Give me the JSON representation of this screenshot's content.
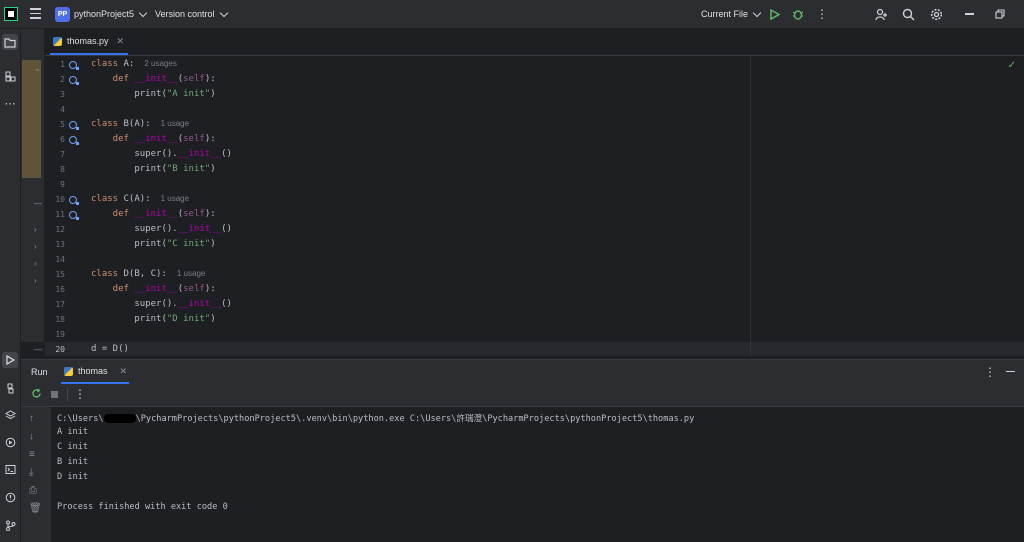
{
  "titlebar": {
    "project_badge": "PP",
    "project_name": "pythonProject5",
    "vcs_label": "Version control",
    "run_config": "Current File"
  },
  "editor": {
    "tab_label": "thomas.py",
    "lines": [
      {
        "n": "1",
        "usage": "2 usages"
      },
      {
        "n": "2"
      },
      {
        "n": "3"
      },
      {
        "n": "4"
      },
      {
        "n": "5",
        "usage": "1 usage"
      },
      {
        "n": "6"
      },
      {
        "n": "7"
      },
      {
        "n": "8"
      },
      {
        "n": "9"
      },
      {
        "n": "10",
        "usage": "1 usage"
      },
      {
        "n": "11"
      },
      {
        "n": "12"
      },
      {
        "n": "13"
      },
      {
        "n": "14"
      },
      {
        "n": "15",
        "usage": "1 usage"
      },
      {
        "n": "16"
      },
      {
        "n": "17"
      },
      {
        "n": "18"
      },
      {
        "n": "19"
      },
      {
        "n": "20"
      }
    ],
    "code": {
      "l1a": "class",
      "l1b": " A:",
      "l2a": "    def ",
      "l2b": "__init__",
      "l2c": "(",
      "l2d": "self",
      "l2e": "):",
      "l3a": "        print(",
      "l3b": "\"A init\"",
      "l3c": ")",
      "l5a": "class",
      "l5b": " B(A):",
      "l6a": "    def ",
      "l6b": "__init__",
      "l6c": "(",
      "l6d": "self",
      "l6e": "):",
      "l7a": "        super().",
      "l7b": "__init__",
      "l7c": "()",
      "l8a": "        print(",
      "l8b": "\"B init\"",
      "l8c": ")",
      "l10a": "class",
      "l10b": " C(A):",
      "l11a": "    def ",
      "l11b": "__init__",
      "l11c": "(",
      "l11d": "self",
      "l11e": "):",
      "l12a": "        super().",
      "l12b": "__init__",
      "l12c": "()",
      "l13a": "        print(",
      "l13b": "\"C init\"",
      "l13c": ")",
      "l15a": "class",
      "l15b": " D(B, C):",
      "l16a": "    def ",
      "l16b": "__init__",
      "l16c": "(",
      "l16d": "self",
      "l16e": "):",
      "l17a": "        super().",
      "l17b": "__init__",
      "l17c": "()",
      "l18a": "        print(",
      "l18b": "\"D init\"",
      "l18c": ")",
      "l20": "d = D()"
    }
  },
  "run": {
    "panel_label": "Run",
    "tab_label": "thomas",
    "cmd_prefix": "C:\\Users\\",
    "cmd_rest": "\\PycharmProjects\\pythonProject5\\.venv\\bin\\python.exe C:\\Users\\許瑞澄\\PycharmProjects\\pythonProject5\\thomas.py",
    "output": [
      "A init",
      "C init",
      "B init",
      "D init"
    ],
    "exit_msg": "Process finished with exit code 0"
  }
}
